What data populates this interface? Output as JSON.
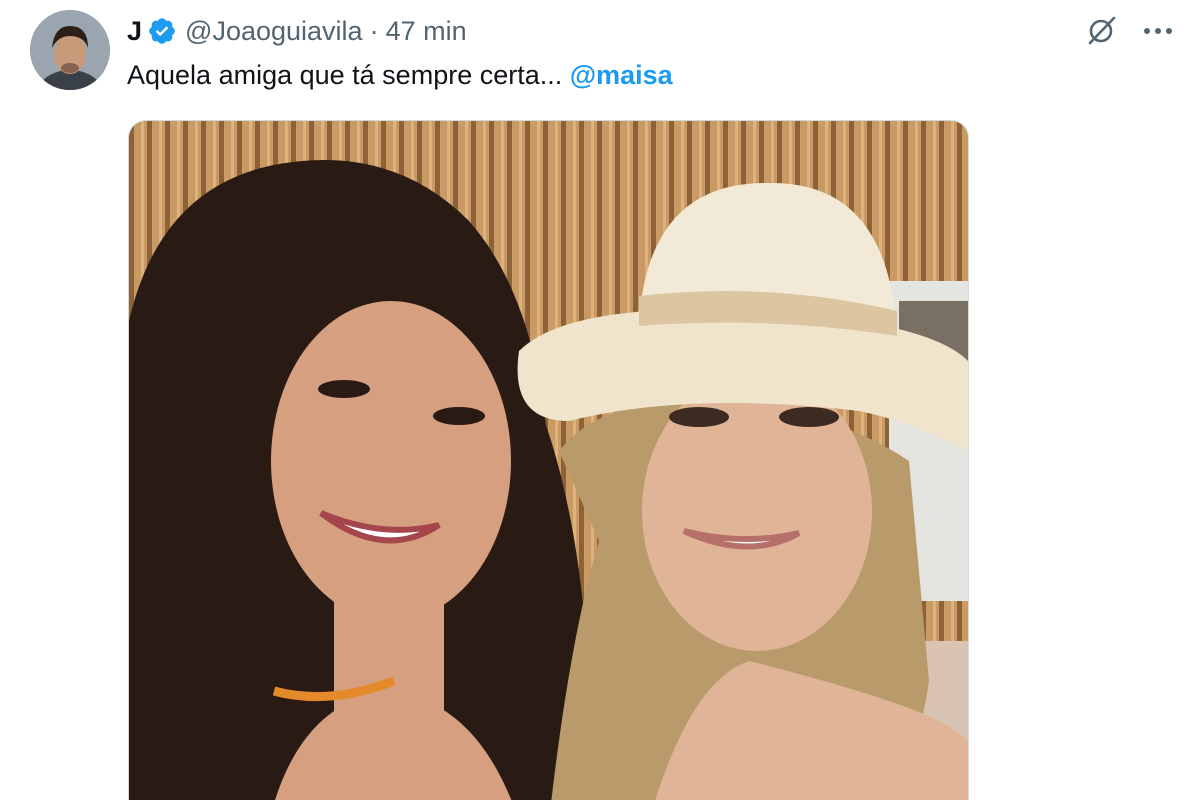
{
  "author": {
    "display_name": "J",
    "verified": true,
    "handle": "@Joaoguiavila",
    "separator": "·",
    "time": "47 min"
  },
  "tweet": {
    "text": "Aquela amiga que tá sempre certa... ",
    "mention": "@maisa"
  },
  "actions": {
    "grok_icon": "grok-icon",
    "more_icon": "more-options-icon"
  },
  "colors": {
    "accent": "#1d9bf0",
    "text": "#0f1419",
    "secondary": "#536471"
  }
}
